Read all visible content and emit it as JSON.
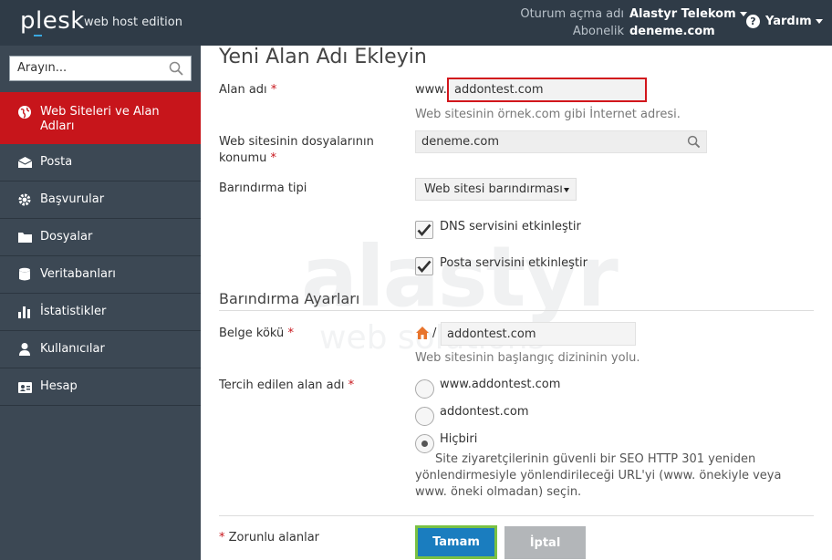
{
  "header": {
    "logo": "plesk",
    "edition": "web host edition",
    "login_label": "Oturum açma adı",
    "login_value": "Alastyr Telekom",
    "subscription_label": "Abonelik",
    "subscription_value": "deneme.com",
    "help_label": "Yardım"
  },
  "sidebar": {
    "search_placeholder": "Arayın...",
    "items": [
      {
        "label": "Web Siteleri ve Alan Adları",
        "icon": "globe-icon"
      },
      {
        "label": "Posta",
        "icon": "mail-icon"
      },
      {
        "label": "Başvurular",
        "icon": "gear-icon"
      },
      {
        "label": "Dosyalar",
        "icon": "folder-icon"
      },
      {
        "label": "Veritabanları",
        "icon": "database-icon"
      },
      {
        "label": "İstatistikler",
        "icon": "bar-chart-icon"
      },
      {
        "label": "Kullanıcılar",
        "icon": "user-icon"
      },
      {
        "label": "Hesap",
        "icon": "account-icon"
      }
    ]
  },
  "watermark": {
    "main": "alastyr",
    "sub": "web solutions"
  },
  "form": {
    "title": "Yeni Alan Adı Ekleyin",
    "domain_label": "Alan adı",
    "www_prefix": "www.",
    "domain_value": "addontest.com",
    "domain_hint": "Web sitesinin örnek.com gibi İnternet adresi.",
    "location_label": "Web sitesinin dosyalarının konumu",
    "location_value": "deneme.com",
    "hosting_label": "Barındırma tipi",
    "hosting_value": "Web sitesi barındırması",
    "dns_label": "DNS servisini etkinleştir",
    "dns_checked": true,
    "mail_label": "Posta servisini etkinleştir",
    "mail_checked": true,
    "section_title": "Barındırma Ayarları",
    "docroot_label": "Belge kökü",
    "docroot_sep": "/",
    "docroot_value": "addontest.com",
    "docroot_hint": "Web sitesinin başlangıç dizininin yolu.",
    "preferred_label": "Tercih edilen alan adı",
    "preferred_options": [
      "www.addontest.com",
      "addontest.com",
      "Hiçbiri"
    ],
    "preferred_selected": "Hiçbiri",
    "preferred_hint": "Site ziyaretçilerinin güvenli bir SEO HTTP 301 yeniden yönlendirmesiyle yönlendirileceği URL'yi (www. önekiyle veya www. öneki olmadan) seçin.",
    "required_note": "Zorunlu alanlar",
    "required_mark": "*",
    "ok_label": "Tamam",
    "cancel_label": "İptal"
  },
  "colors": {
    "header_bg": "#2f3b47",
    "sidebar_bg": "#3c4854",
    "active_item": "#c7151b",
    "ok_button": "#1a7dbf",
    "ok_border": "#7ac143",
    "cancel_button": "#b3b6b9"
  }
}
